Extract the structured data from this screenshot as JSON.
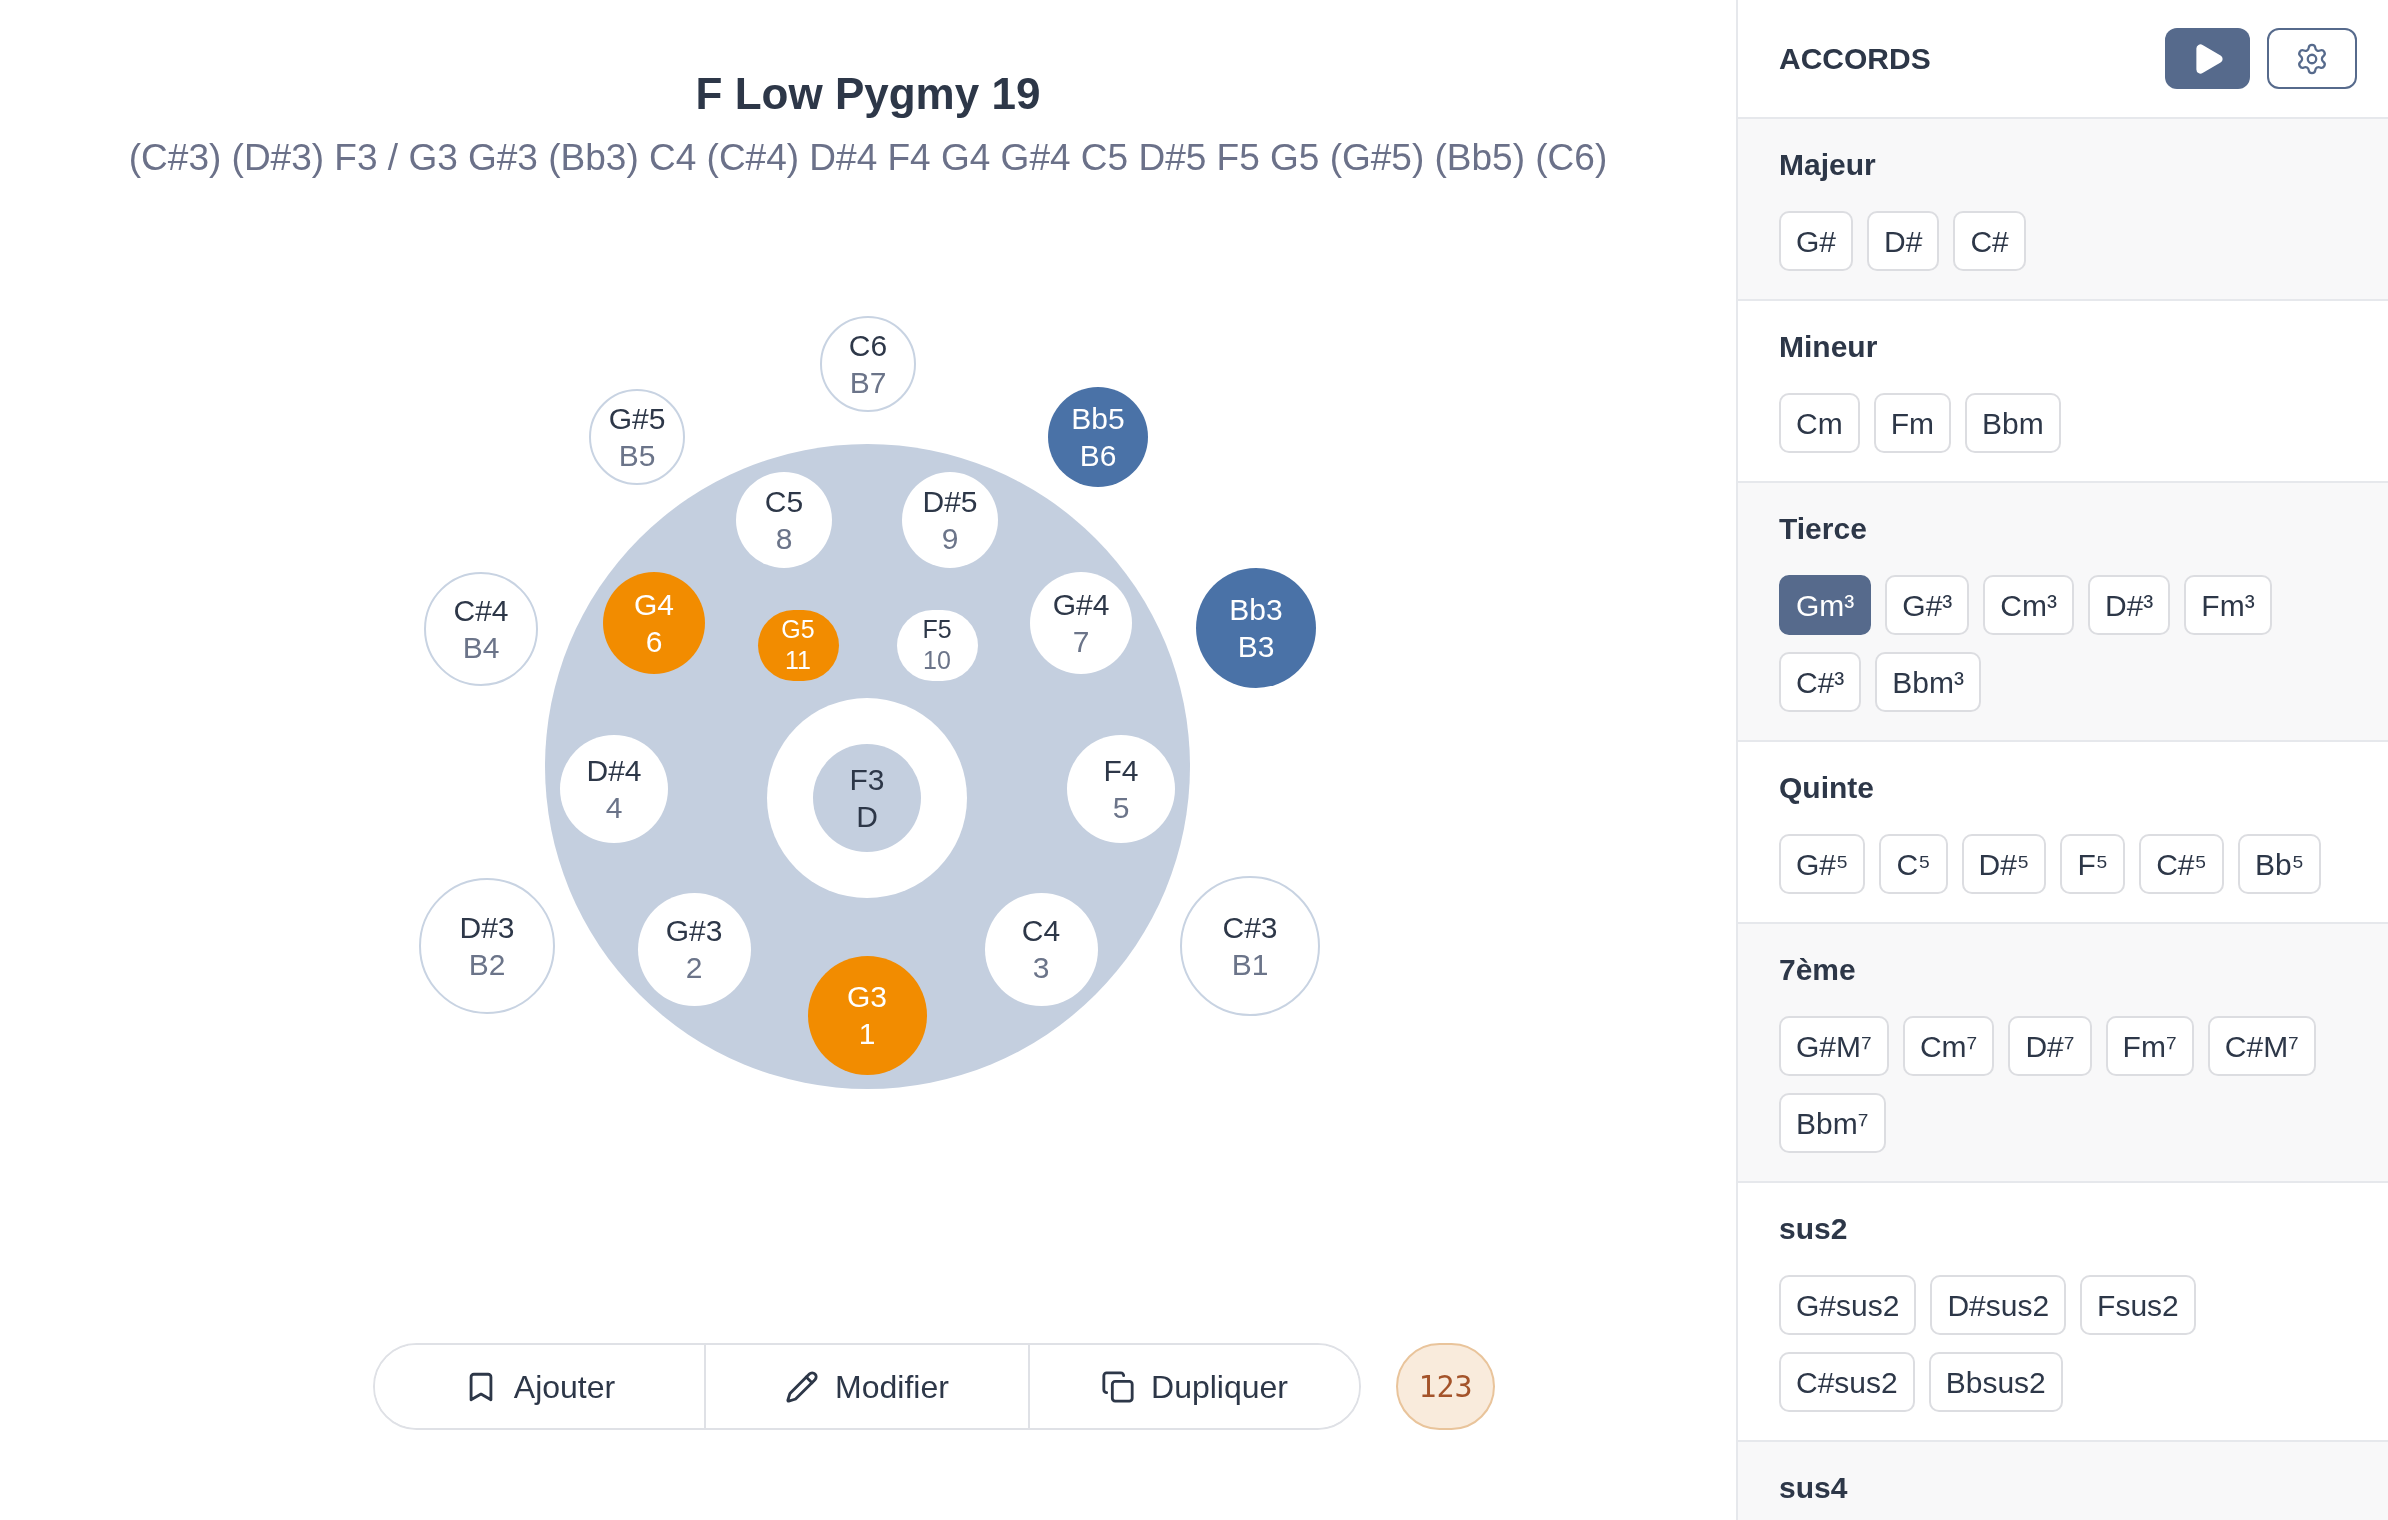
{
  "title": "F Low Pygmy 19",
  "scale_notes": "(C#3) (D#3) F3 / G3 G#3 (Bb3) C4 (C#4) D#4 F4 G4 G#4 C5 D#5 F5 G5 (G#5) (Bb5) (C6)",
  "notes": [
    {
      "kind": "ding",
      "label": "F3",
      "number": "D"
    },
    {
      "kind": "top",
      "label": "G3",
      "number": "1",
      "color": "#f28c00"
    },
    {
      "kind": "top",
      "label": "G#3",
      "number": "2"
    },
    {
      "kind": "top",
      "label": "C4",
      "number": "3"
    },
    {
      "kind": "top",
      "label": "D#4",
      "number": "4"
    },
    {
      "kind": "top",
      "label": "F4",
      "number": "5"
    },
    {
      "kind": "top",
      "label": "G4",
      "number": "6",
      "color": "#f28c00"
    },
    {
      "kind": "top",
      "label": "G#4",
      "number": "7"
    },
    {
      "kind": "top",
      "label": "C5",
      "number": "8"
    },
    {
      "kind": "top",
      "label": "D#5",
      "number": "9"
    },
    {
      "kind": "top",
      "label": "G5",
      "number": "11",
      "color": "#f28c00"
    },
    {
      "kind": "top",
      "label": "F5",
      "number": "10"
    },
    {
      "kind": "bottom",
      "label": "D#3",
      "number": "B2"
    },
    {
      "kind": "bottom",
      "label": "C#3",
      "number": "B1"
    },
    {
      "kind": "bottom",
      "label": "C#4",
      "number": "B4"
    },
    {
      "kind": "bottom",
      "label": "Bb3",
      "number": "B3",
      "color": "#4a72a7"
    },
    {
      "kind": "bottom",
      "label": "G#5",
      "number": "B5"
    },
    {
      "kind": "bottom",
      "label": "Bb5",
      "number": "B6",
      "color": "#4a72a7"
    },
    {
      "kind": "bottom",
      "label": "C6",
      "number": "B7"
    }
  ],
  "actions": [
    {
      "label": "Ajouter"
    },
    {
      "label": "Modifier"
    },
    {
      "label": "Dupliquer"
    }
  ],
  "counter": "123",
  "sidebar": {
    "title": "ACCORDS",
    "groups": [
      {
        "name": "Majeur",
        "chords": [
          {
            "label": "G#",
            "selected": false
          },
          {
            "label": "D#",
            "selected": false
          },
          {
            "label": "C#",
            "selected": false
          }
        ]
      },
      {
        "name": "Mineur",
        "chords": [
          {
            "label": "Cm",
            "selected": false
          },
          {
            "label": "Fm",
            "selected": false
          },
          {
            "label": "Bbm",
            "selected": false
          }
        ]
      },
      {
        "name": "Tierce",
        "chords": [
          {
            "label": "Gm³",
            "selected": true
          },
          {
            "label": "G#³",
            "selected": false
          },
          {
            "label": "Cm³",
            "selected": false
          },
          {
            "label": "D#³",
            "selected": false
          },
          {
            "label": "Fm³",
            "selected": false
          },
          {
            "label": "C#³",
            "selected": false
          },
          {
            "label": "Bbm³",
            "selected": false
          }
        ]
      },
      {
        "name": "Quinte",
        "chords": [
          {
            "label": "G#⁵",
            "selected": false
          },
          {
            "label": "C⁵",
            "selected": false
          },
          {
            "label": "D#⁵",
            "selected": false
          },
          {
            "label": "F⁵",
            "selected": false
          },
          {
            "label": "C#⁵",
            "selected": false
          },
          {
            "label": "Bb⁵",
            "selected": false
          }
        ]
      },
      {
        "name": "7ème",
        "chords": [
          {
            "label": "G#M⁷",
            "selected": false
          },
          {
            "label": "Cm⁷",
            "selected": false
          },
          {
            "label": "D#⁷",
            "selected": false
          },
          {
            "label": "Fm⁷",
            "selected": false
          },
          {
            "label": "C#M⁷",
            "selected": false
          },
          {
            "label": "Bbm⁷",
            "selected": false
          }
        ]
      },
      {
        "name": "sus2",
        "chords": [
          {
            "label": "G#sus2",
            "selected": false
          },
          {
            "label": "D#sus2",
            "selected": false
          },
          {
            "label": "Fsus2",
            "selected": false
          },
          {
            "label": "C#sus2",
            "selected": false
          },
          {
            "label": "Bbsus2",
            "selected": false
          }
        ]
      },
      {
        "name": "sus4"
      }
    ]
  }
}
